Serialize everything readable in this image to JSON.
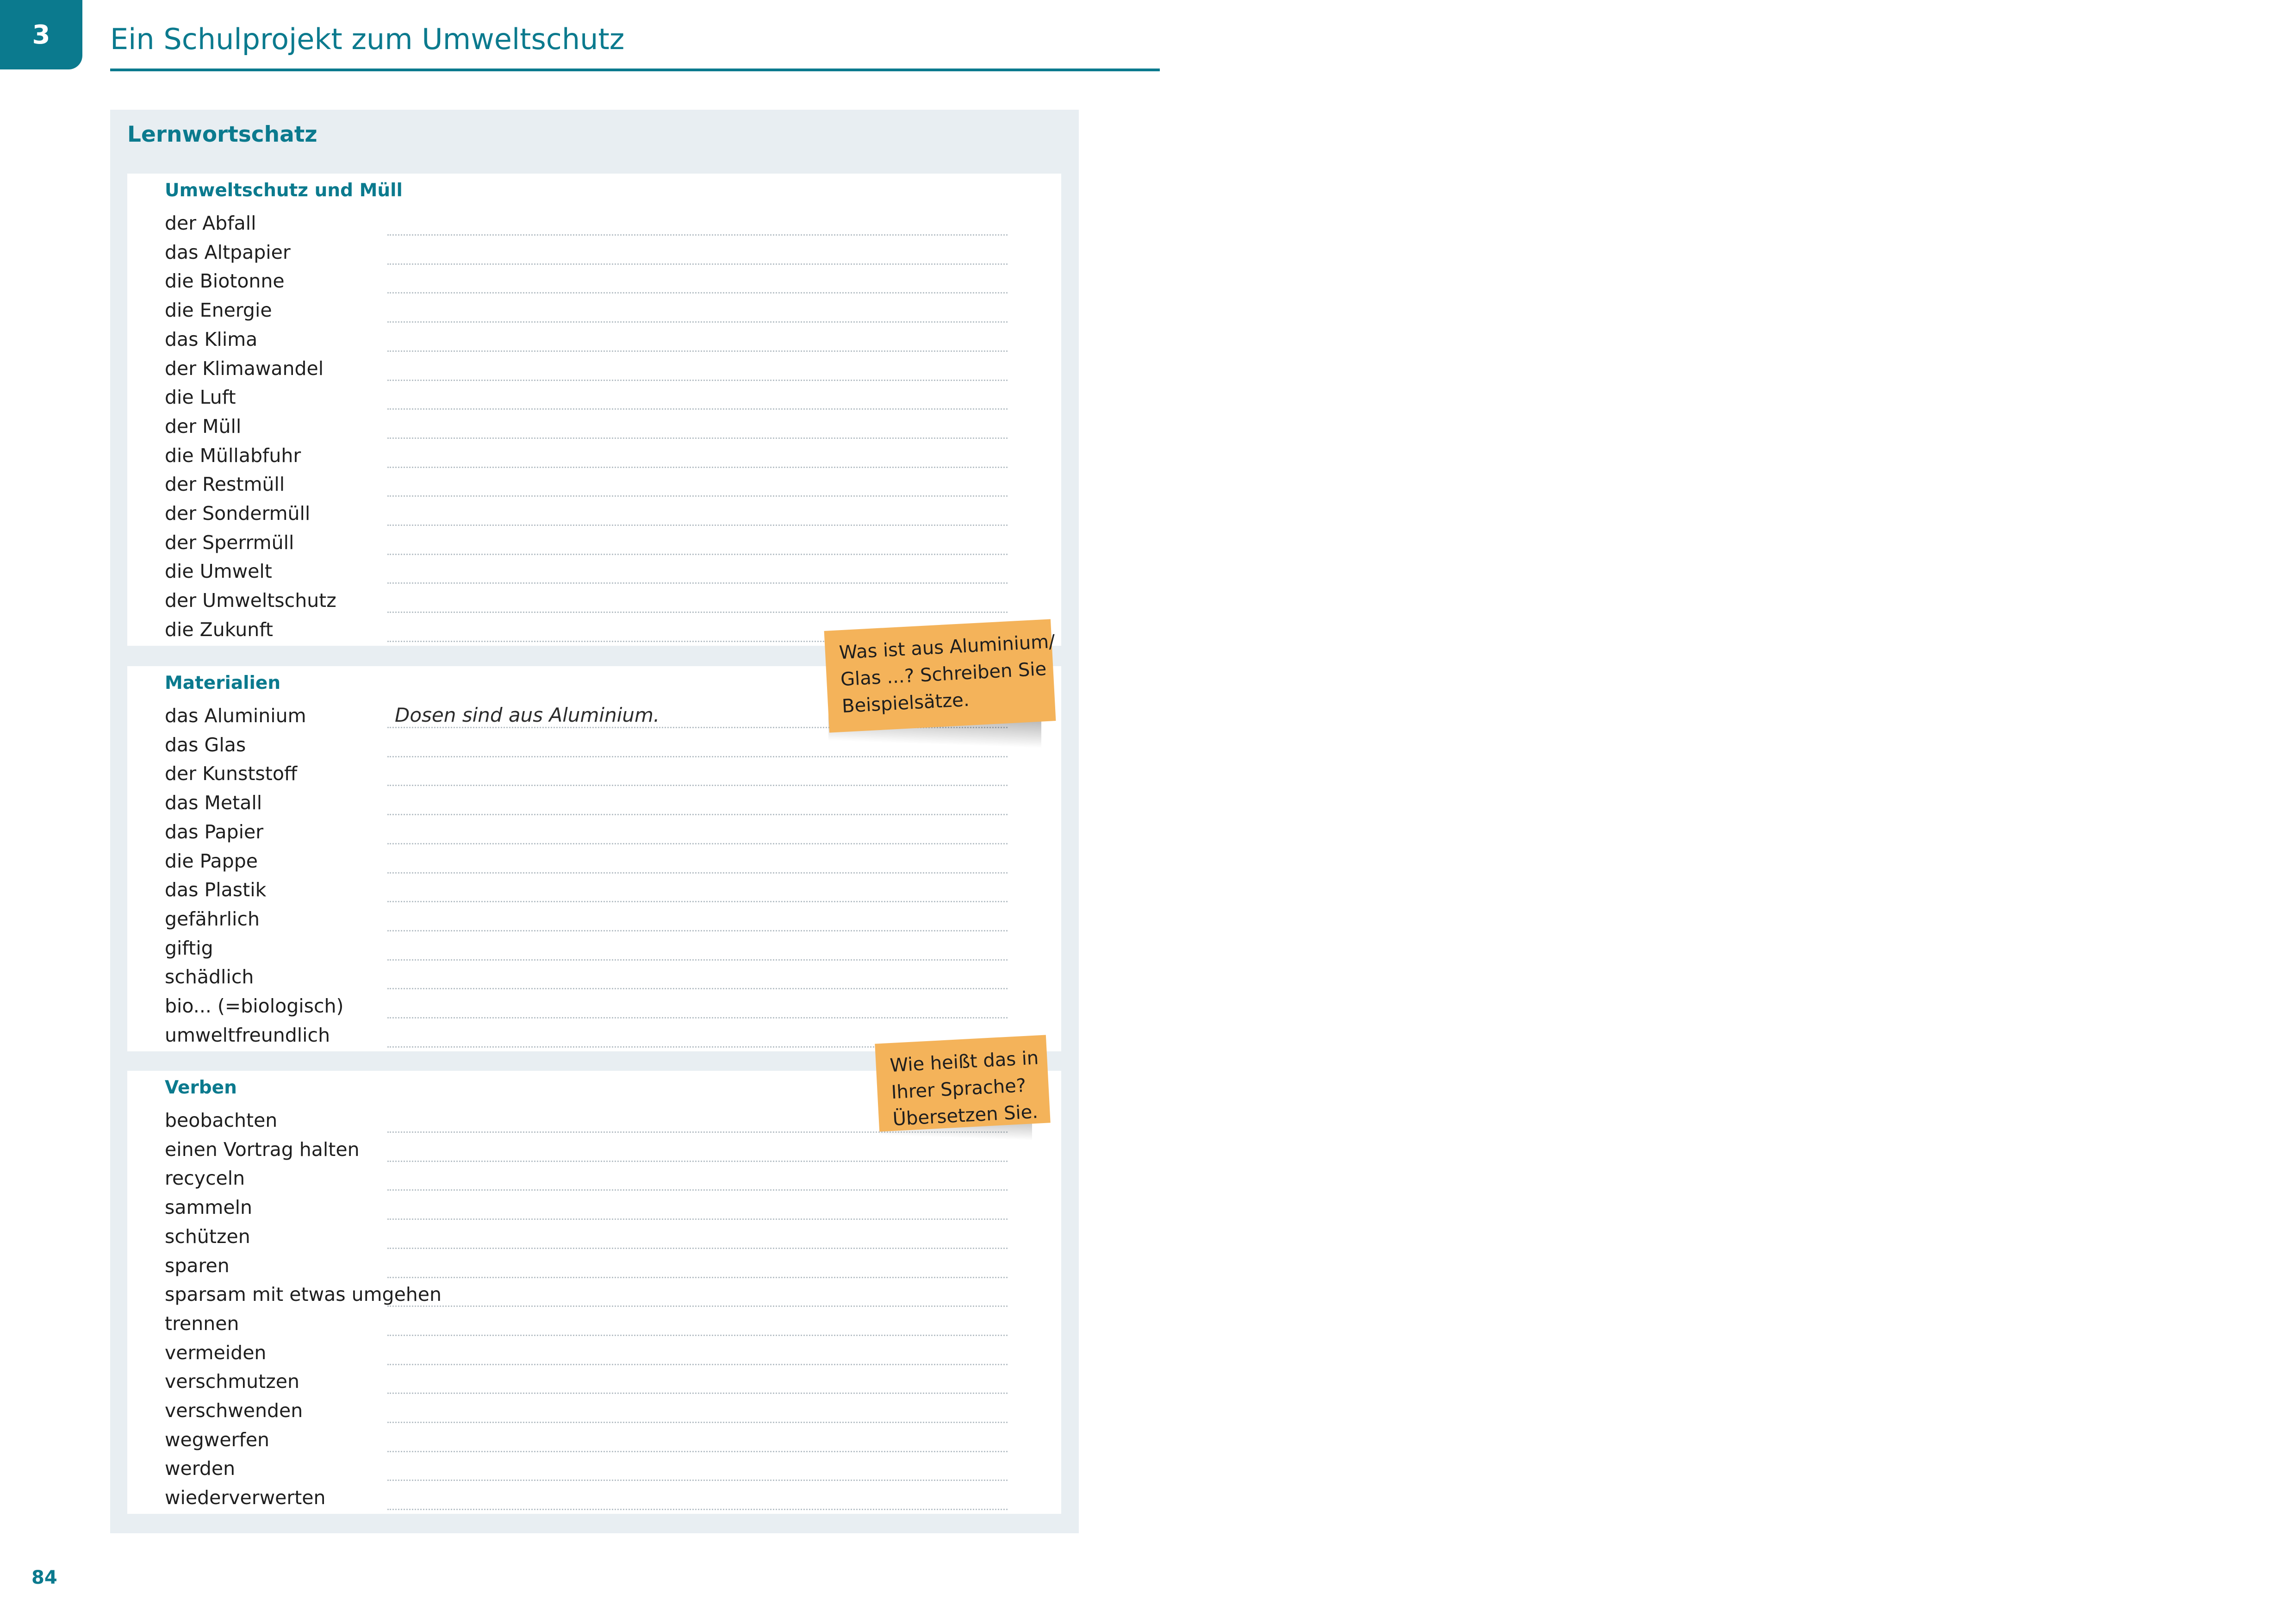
{
  "header": {
    "chapter_number": "3",
    "chapter_title": "Ein Schulprojekt zum Umweltschutz"
  },
  "panel": {
    "heading": "Lernwortschatz",
    "sections": [
      {
        "heading": "Umweltschutz und Müll",
        "terms": [
          "der Abfall",
          "das Altpapier",
          "die Biotonne",
          "die Energie",
          "das Klima",
          "der Klimawandel",
          "die Luft",
          "der Müll",
          "die Müllabfuhr",
          "der Restmüll",
          "der Sondermüll",
          "der Sperrmüll",
          "die Umwelt",
          "der Umweltschutz",
          "die Zukunft"
        ],
        "answers": {}
      },
      {
        "heading": "Materialien",
        "terms": [
          "das Aluminium",
          "das Glas",
          "der Kunststoff",
          "das Metall",
          "das Papier",
          "die Pappe",
          "das Plastik",
          "gefährlich",
          "giftig",
          "schädlich",
          "bio... (=biologisch)",
          "umweltfreundlich"
        ],
        "answers": {
          "0": "Dosen sind aus Aluminium."
        }
      },
      {
        "heading": "Verben",
        "terms": [
          "beobachten",
          "einen Vortrag halten",
          "recyceln",
          "sammeln",
          "schützen",
          "sparen",
          "sparsam mit etwas umgehen",
          "trennen",
          "vermeiden",
          "verschmutzen",
          "verschwenden",
          "wegwerfen",
          "werden",
          "wiederverwerten"
        ],
        "answers": {}
      }
    ]
  },
  "notes": [
    {
      "lines": [
        "Was ist aus Aluminium/",
        "Glas ...? Schreiben Sie",
        "Beispielsätze."
      ]
    },
    {
      "lines": [
        "Wie heißt das in",
        "Ihrer Sprache?",
        "Übersetzen Sie."
      ]
    }
  ],
  "footer": {
    "page_number": "84"
  },
  "colors": {
    "accent": "#0b7a8e",
    "panel_bg": "#e8eef2",
    "note_bg": "#f4b35a"
  }
}
